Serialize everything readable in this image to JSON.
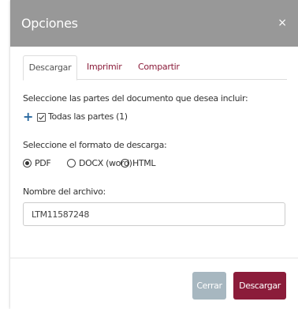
{
  "dialog": {
    "title": "Opciones",
    "close_icon": "close-icon",
    "close_glyph": "×"
  },
  "tabs": [
    {
      "label": "Descargar",
      "active": true
    },
    {
      "label": "Imprimir",
      "active": false
    },
    {
      "label": "Compartir",
      "active": false
    }
  ],
  "parts": {
    "instruction": "Seleccione las partes del documento que desea incluir:",
    "expand_icon": "plus-icon",
    "expand_glyph": "+",
    "all_parts_label": "Todas las partes (1)",
    "all_parts_checked": true
  },
  "format": {
    "instruction": "Seleccione el formato de descarga:",
    "options": [
      {
        "label": "PDF",
        "selected": true
      },
      {
        "label": "DOCX (word)",
        "selected": false
      },
      {
        "label": "HTML",
        "selected": false
      }
    ]
  },
  "filename": {
    "label": "Nombre del archivo:",
    "value": "LTM11587248"
  },
  "buttons": {
    "cancel": "Cerrar",
    "primary": "Descargar"
  },
  "colors": {
    "header_bg": "#989898",
    "accent": "#8b1c3a",
    "cancel_bg": "#a7b7c0",
    "plus": "#2b6aa0"
  }
}
